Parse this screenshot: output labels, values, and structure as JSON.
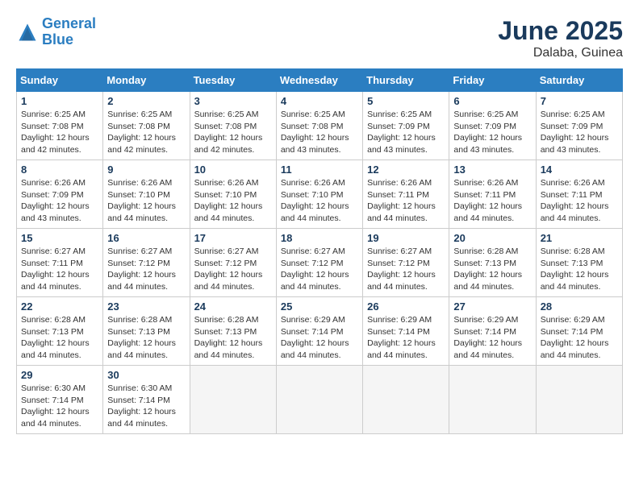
{
  "logo": {
    "line1": "General",
    "line2": "Blue"
  },
  "title": "June 2025",
  "subtitle": "Dalaba, Guinea",
  "days_header": [
    "Sunday",
    "Monday",
    "Tuesday",
    "Wednesday",
    "Thursday",
    "Friday",
    "Saturday"
  ],
  "weeks": [
    [
      {
        "day": "1",
        "sunrise": "Sunrise: 6:25 AM",
        "sunset": "Sunset: 7:08 PM",
        "daylight": "Daylight: 12 hours and 42 minutes."
      },
      {
        "day": "2",
        "sunrise": "Sunrise: 6:25 AM",
        "sunset": "Sunset: 7:08 PM",
        "daylight": "Daylight: 12 hours and 42 minutes."
      },
      {
        "day": "3",
        "sunrise": "Sunrise: 6:25 AM",
        "sunset": "Sunset: 7:08 PM",
        "daylight": "Daylight: 12 hours and 42 minutes."
      },
      {
        "day": "4",
        "sunrise": "Sunrise: 6:25 AM",
        "sunset": "Sunset: 7:08 PM",
        "daylight": "Daylight: 12 hours and 43 minutes."
      },
      {
        "day": "5",
        "sunrise": "Sunrise: 6:25 AM",
        "sunset": "Sunset: 7:09 PM",
        "daylight": "Daylight: 12 hours and 43 minutes."
      },
      {
        "day": "6",
        "sunrise": "Sunrise: 6:25 AM",
        "sunset": "Sunset: 7:09 PM",
        "daylight": "Daylight: 12 hours and 43 minutes."
      },
      {
        "day": "7",
        "sunrise": "Sunrise: 6:25 AM",
        "sunset": "Sunset: 7:09 PM",
        "daylight": "Daylight: 12 hours and 43 minutes."
      }
    ],
    [
      {
        "day": "8",
        "sunrise": "Sunrise: 6:26 AM",
        "sunset": "Sunset: 7:09 PM",
        "daylight": "Daylight: 12 hours and 43 minutes."
      },
      {
        "day": "9",
        "sunrise": "Sunrise: 6:26 AM",
        "sunset": "Sunset: 7:10 PM",
        "daylight": "Daylight: 12 hours and 44 minutes."
      },
      {
        "day": "10",
        "sunrise": "Sunrise: 6:26 AM",
        "sunset": "Sunset: 7:10 PM",
        "daylight": "Daylight: 12 hours and 44 minutes."
      },
      {
        "day": "11",
        "sunrise": "Sunrise: 6:26 AM",
        "sunset": "Sunset: 7:10 PM",
        "daylight": "Daylight: 12 hours and 44 minutes."
      },
      {
        "day": "12",
        "sunrise": "Sunrise: 6:26 AM",
        "sunset": "Sunset: 7:11 PM",
        "daylight": "Daylight: 12 hours and 44 minutes."
      },
      {
        "day": "13",
        "sunrise": "Sunrise: 6:26 AM",
        "sunset": "Sunset: 7:11 PM",
        "daylight": "Daylight: 12 hours and 44 minutes."
      },
      {
        "day": "14",
        "sunrise": "Sunrise: 6:26 AM",
        "sunset": "Sunset: 7:11 PM",
        "daylight": "Daylight: 12 hours and 44 minutes."
      }
    ],
    [
      {
        "day": "15",
        "sunrise": "Sunrise: 6:27 AM",
        "sunset": "Sunset: 7:11 PM",
        "daylight": "Daylight: 12 hours and 44 minutes."
      },
      {
        "day": "16",
        "sunrise": "Sunrise: 6:27 AM",
        "sunset": "Sunset: 7:12 PM",
        "daylight": "Daylight: 12 hours and 44 minutes."
      },
      {
        "day": "17",
        "sunrise": "Sunrise: 6:27 AM",
        "sunset": "Sunset: 7:12 PM",
        "daylight": "Daylight: 12 hours and 44 minutes."
      },
      {
        "day": "18",
        "sunrise": "Sunrise: 6:27 AM",
        "sunset": "Sunset: 7:12 PM",
        "daylight": "Daylight: 12 hours and 44 minutes."
      },
      {
        "day": "19",
        "sunrise": "Sunrise: 6:27 AM",
        "sunset": "Sunset: 7:12 PM",
        "daylight": "Daylight: 12 hours and 44 minutes."
      },
      {
        "day": "20",
        "sunrise": "Sunrise: 6:28 AM",
        "sunset": "Sunset: 7:13 PM",
        "daylight": "Daylight: 12 hours and 44 minutes."
      },
      {
        "day": "21",
        "sunrise": "Sunrise: 6:28 AM",
        "sunset": "Sunset: 7:13 PM",
        "daylight": "Daylight: 12 hours and 44 minutes."
      }
    ],
    [
      {
        "day": "22",
        "sunrise": "Sunrise: 6:28 AM",
        "sunset": "Sunset: 7:13 PM",
        "daylight": "Daylight: 12 hours and 44 minutes."
      },
      {
        "day": "23",
        "sunrise": "Sunrise: 6:28 AM",
        "sunset": "Sunset: 7:13 PM",
        "daylight": "Daylight: 12 hours and 44 minutes."
      },
      {
        "day": "24",
        "sunrise": "Sunrise: 6:28 AM",
        "sunset": "Sunset: 7:13 PM",
        "daylight": "Daylight: 12 hours and 44 minutes."
      },
      {
        "day": "25",
        "sunrise": "Sunrise: 6:29 AM",
        "sunset": "Sunset: 7:14 PM",
        "daylight": "Daylight: 12 hours and 44 minutes."
      },
      {
        "day": "26",
        "sunrise": "Sunrise: 6:29 AM",
        "sunset": "Sunset: 7:14 PM",
        "daylight": "Daylight: 12 hours and 44 minutes."
      },
      {
        "day": "27",
        "sunrise": "Sunrise: 6:29 AM",
        "sunset": "Sunset: 7:14 PM",
        "daylight": "Daylight: 12 hours and 44 minutes."
      },
      {
        "day": "28",
        "sunrise": "Sunrise: 6:29 AM",
        "sunset": "Sunset: 7:14 PM",
        "daylight": "Daylight: 12 hours and 44 minutes."
      }
    ],
    [
      {
        "day": "29",
        "sunrise": "Sunrise: 6:30 AM",
        "sunset": "Sunset: 7:14 PM",
        "daylight": "Daylight: 12 hours and 44 minutes."
      },
      {
        "day": "30",
        "sunrise": "Sunrise: 6:30 AM",
        "sunset": "Sunset: 7:14 PM",
        "daylight": "Daylight: 12 hours and 44 minutes."
      },
      {
        "day": "",
        "sunrise": "",
        "sunset": "",
        "daylight": ""
      },
      {
        "day": "",
        "sunrise": "",
        "sunset": "",
        "daylight": ""
      },
      {
        "day": "",
        "sunrise": "",
        "sunset": "",
        "daylight": ""
      },
      {
        "day": "",
        "sunrise": "",
        "sunset": "",
        "daylight": ""
      },
      {
        "day": "",
        "sunrise": "",
        "sunset": "",
        "daylight": ""
      }
    ]
  ]
}
